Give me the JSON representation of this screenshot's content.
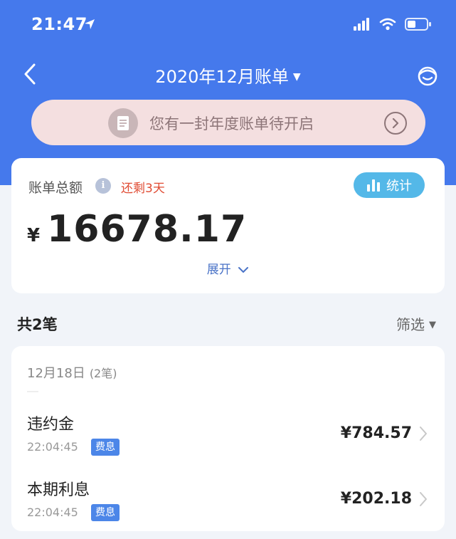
{
  "status_bar": {
    "time": "21:47"
  },
  "nav": {
    "title": "2020年12月账单",
    "title_caret": "▼"
  },
  "annual_banner": {
    "text": "您有一封年度账单待开启"
  },
  "summary": {
    "label": "账单总额",
    "info_glyph": "i",
    "due_text": "还剩3天",
    "stats_label": "统计",
    "currency": "¥",
    "amount": "16678.17",
    "expand_label": "展开"
  },
  "list_header": {
    "count_label": "共2笔",
    "filter_label": "筛选",
    "filter_caret": "▼"
  },
  "transactions": {
    "date": "12月18日",
    "date_count": "(2笔)",
    "items": [
      {
        "name": "违约金",
        "time": "22:04:45",
        "tag": "费息",
        "amount": "¥784.57"
      },
      {
        "name": "本期利息",
        "time": "22:04:45",
        "tag": "费息",
        "amount": "¥202.18"
      }
    ]
  },
  "colors": {
    "header_bg": "#4579ec",
    "banner_bg": "#f4dfe0",
    "stats_button": "#54b8e8",
    "due_text": "#e04b33",
    "tag_bg": "#4c86e8",
    "page_bg": "#f1f4f9"
  }
}
